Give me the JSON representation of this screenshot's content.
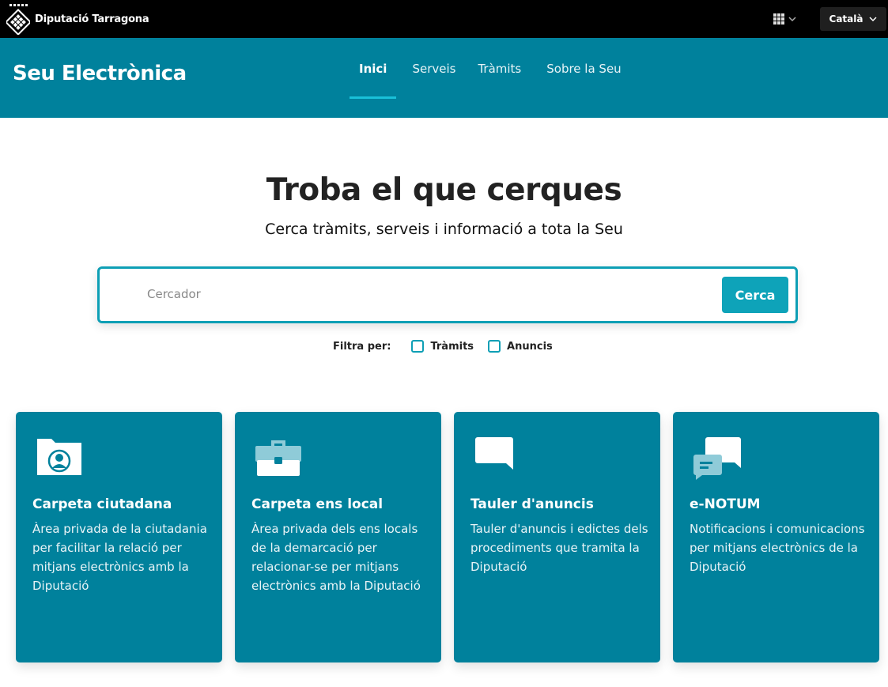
{
  "topbar": {
    "brand_name": "Diputació Tarragona",
    "apps_icon": "grid-icon",
    "language": "Català"
  },
  "header": {
    "site_title": "Seu Electrònica",
    "nav": [
      {
        "label": "Inici",
        "active": true
      },
      {
        "label": "Serveis",
        "active": false
      },
      {
        "label": "Tràmits",
        "active": false
      },
      {
        "label": "Sobre la Seu",
        "active": false
      }
    ]
  },
  "hero": {
    "title": "Troba el que cerques",
    "subtitle": "Cerca tràmits, serveis i informació a tota la Seu"
  },
  "search": {
    "placeholder": "Cercador",
    "value": "",
    "button_label": "Cerca",
    "filter_label": "Filtra per:",
    "filters": [
      {
        "label": "Tràmits",
        "checked": false
      },
      {
        "label": "Anuncis",
        "checked": false
      }
    ]
  },
  "cards": [
    {
      "icon": "folder-user-icon",
      "title": "Carpeta ciutadana",
      "description": "Àrea privada de la ciutadania per facilitar la relació per mitjans electrònics amb la Diputació"
    },
    {
      "icon": "briefcase-icon",
      "title": "Carpeta ens local",
      "description": "Àrea privada dels ens locals de la demarcació per relacionar-se per mitjans electrònics amb la Diputació"
    },
    {
      "icon": "speech-bubble-icon",
      "title": "Tauler d'anuncis",
      "description": "Tauler d'anuncis i edictes dels procediments que tramita la Diputació"
    },
    {
      "icon": "chat-bubbles-icon",
      "title": "e-NOTUM",
      "description": "Notificacions i comunicacions per mitjans electrònics de la Diputació"
    }
  ],
  "colors": {
    "brand_teal": "#00819c",
    "accent_cyan": "#0ea3b9",
    "topbar_black": "#000000"
  }
}
